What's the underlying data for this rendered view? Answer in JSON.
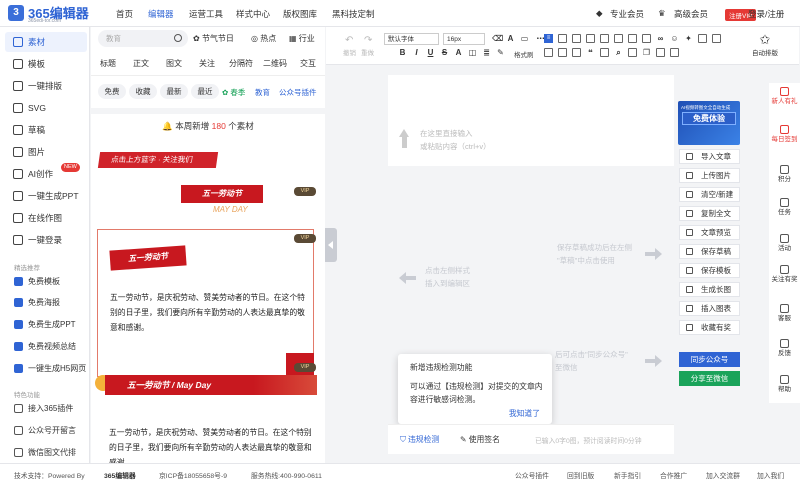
{
  "app": {
    "logo_text": "365编辑器",
    "logo_sub": "365edi-tor.com",
    "nav": [
      "首页",
      "编辑器",
      "运营工具",
      "样式中心",
      "版权图库",
      "黑科技定制"
    ],
    "active_nav": "编辑器",
    "pro_member": "专业会员",
    "adv_member": "高级会员",
    "vip_tag": "注册VIP",
    "login": "登录/注册"
  },
  "sidebar": {
    "items": [
      "素材",
      "模板",
      "一键排版",
      "SVG",
      "草稿",
      "图片",
      "AI创作",
      "一键生成PPT",
      "在线作图",
      "一键登录"
    ],
    "new_badge": "NEW",
    "section1": "精选推荐",
    "recommend": [
      "免费模板",
      "免费海报",
      "免费生成PPT",
      "免费视频总结",
      "一键生成H5网页"
    ],
    "section2": "特色功能",
    "features": [
      "接入365插件",
      "公众号开留言",
      "微信图文代排"
    ]
  },
  "materials": {
    "search_placeholder": "教育",
    "quick": [
      "节气节日",
      "热点",
      "行业"
    ],
    "tabs": [
      "标题",
      "正文",
      "图文",
      "关注",
      "分隔符",
      "二维码",
      "交互"
    ],
    "filters": [
      "免费",
      "收藏",
      "最新",
      "最近"
    ],
    "tags": [
      "春季",
      "教育",
      "公众号插件"
    ],
    "weekly_prefix": "本周新增",
    "weekly_count": "180",
    "weekly_suffix": "个素材",
    "banner_text": "点击上方蓝字 · 关注我们",
    "vip": "VIP",
    "tpl2_label": "五一劳动节",
    "tpl2_sub": "MAY DAY",
    "tpl3_label": "五一劳动节",
    "tpl3_body": "五一劳动节，是庆祝劳动、赞美劳动者的节日。在这个特别的日子里，我们要向所有辛勤劳动的人表达最真挚的敬意和感谢。",
    "tpl4_label": "五一劳动节 / May Day",
    "tpl4_body": "五一劳动节，是庆祝劳动、赞美劳动者的节日。在这个特别的日子里，我们要向所有辛勤劳动的人表达最真挚的敬意和感谢。"
  },
  "toolbar": {
    "undo": "撤销",
    "redo": "重做",
    "font": "默认字体",
    "size": "16px",
    "format": "格式刷",
    "auto": "自动排版"
  },
  "editor": {
    "placeholder_line1": "在这里直接输入",
    "placeholder_line2": "或粘贴内容（ctrl+v）",
    "hint_left_line1": "点击左侧样式",
    "hint_left_line2": "插入到编辑区",
    "hint_right_line1": "保存草稿成功后在左侧",
    "hint_right_line2": "\"草稿\"中点击使用",
    "hint_sync_line1": "后可点击\"同步公众号\"",
    "hint_sync_line2": "至微信",
    "word_count": "已输入0字0图，预计阅读时间0分钟",
    "check_btn": "违规检测",
    "sign_btn": "使用签名"
  },
  "promo": {
    "line1": "AI视频转图文全自动生成",
    "line2": "免费体验"
  },
  "actions": [
    "导入文章",
    "上传图片",
    "清空/新建",
    "复制全文",
    "文章预览",
    "保存草稿",
    "保存模板",
    "生成长图",
    "插入图表",
    "收藏有奖"
  ],
  "sync_btn": "同步公众号",
  "share_btn": "分享至微信",
  "popup": {
    "title": "新增违规检测功能",
    "body": "可以通过【违规检测】对提交的文章内容进行敏感词检测。",
    "ok": "我知道了"
  },
  "right_sidebar": [
    "新人有礼",
    "每日签到",
    "积分",
    "任务",
    "活动",
    "关注有奖",
    "客服",
    "反馈",
    "帮助"
  ],
  "footer": {
    "support": "技术支持：Powered By",
    "brand": "365编辑器",
    "icp": "京ICP备18055658号-9",
    "phone": "服务热线:400-990-0611",
    "links": [
      "公众号插件",
      "回到旧版",
      "新手指引",
      "合作推广",
      "加入交流群",
      "加入我们"
    ]
  },
  "colors": {
    "brand_blue": "#2f64d4",
    "festival_red": "#c8181f",
    "share_green": "#1aa35a"
  }
}
